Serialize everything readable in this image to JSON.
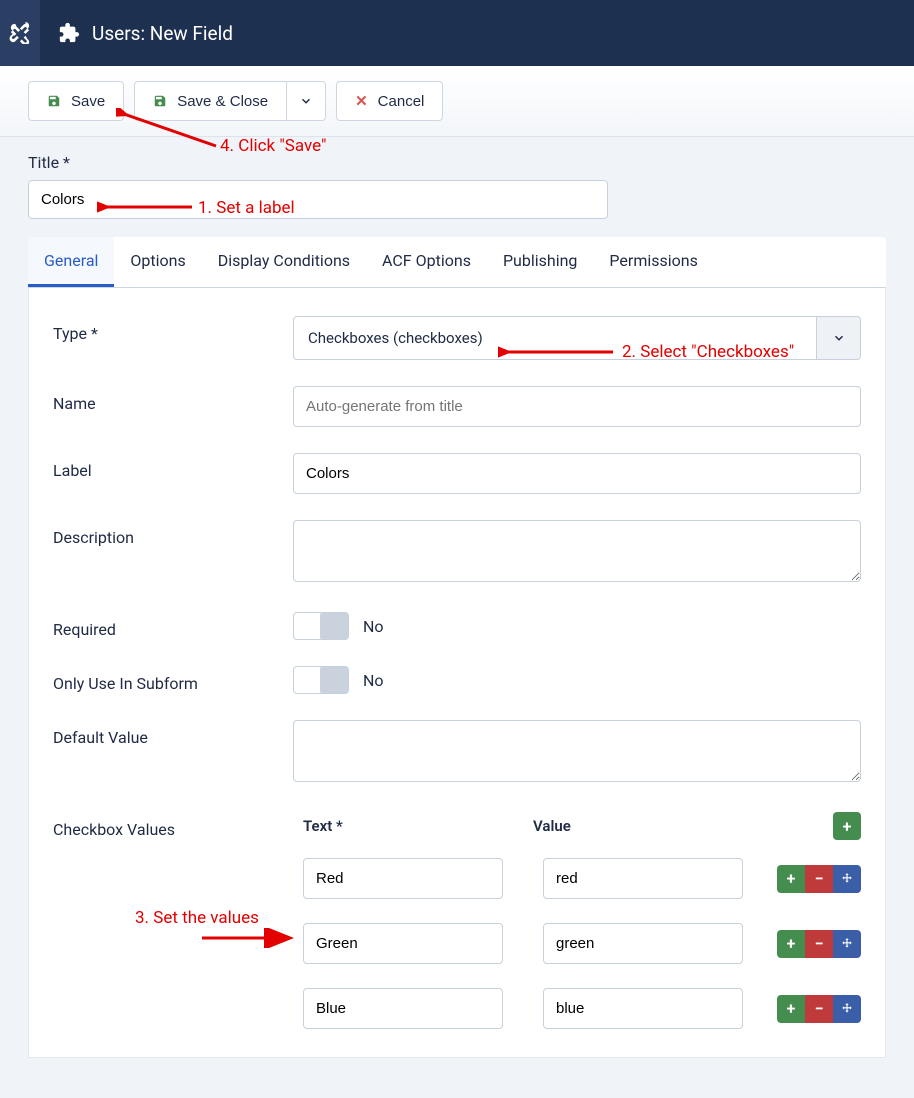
{
  "header": {
    "title": "Users: New Field"
  },
  "toolbar": {
    "save": "Save",
    "save_close": "Save & Close",
    "cancel": "Cancel"
  },
  "title_field": {
    "label": "Title *",
    "value": "Colors"
  },
  "tabs": [
    "General",
    "Options",
    "Display Conditions",
    "ACF Options",
    "Publishing",
    "Permissions"
  ],
  "form": {
    "type": {
      "label": "Type *",
      "value": "Checkboxes (checkboxes)"
    },
    "name": {
      "label": "Name",
      "placeholder": "Auto-generate from title",
      "value": ""
    },
    "labelf": {
      "label": "Label",
      "value": "Colors"
    },
    "description": {
      "label": "Description",
      "value": ""
    },
    "required": {
      "label": "Required",
      "value": "No"
    },
    "subform": {
      "label": "Only Use In Subform",
      "value": "No"
    },
    "default_value": {
      "label": "Default Value",
      "value": ""
    },
    "checkbox_values": {
      "label": "Checkbox Values",
      "text_header": "Text *",
      "value_header": "Value",
      "rows": [
        {
          "text": "Red",
          "value": "red"
        },
        {
          "text": "Green",
          "value": "green"
        },
        {
          "text": "Blue",
          "value": "blue"
        }
      ]
    }
  },
  "annotations": {
    "step1": "1. Set a label",
    "step2": "2. Select \"Checkboxes\"",
    "step3": "3. Set the values",
    "step4": "4. Click \"Save\""
  }
}
